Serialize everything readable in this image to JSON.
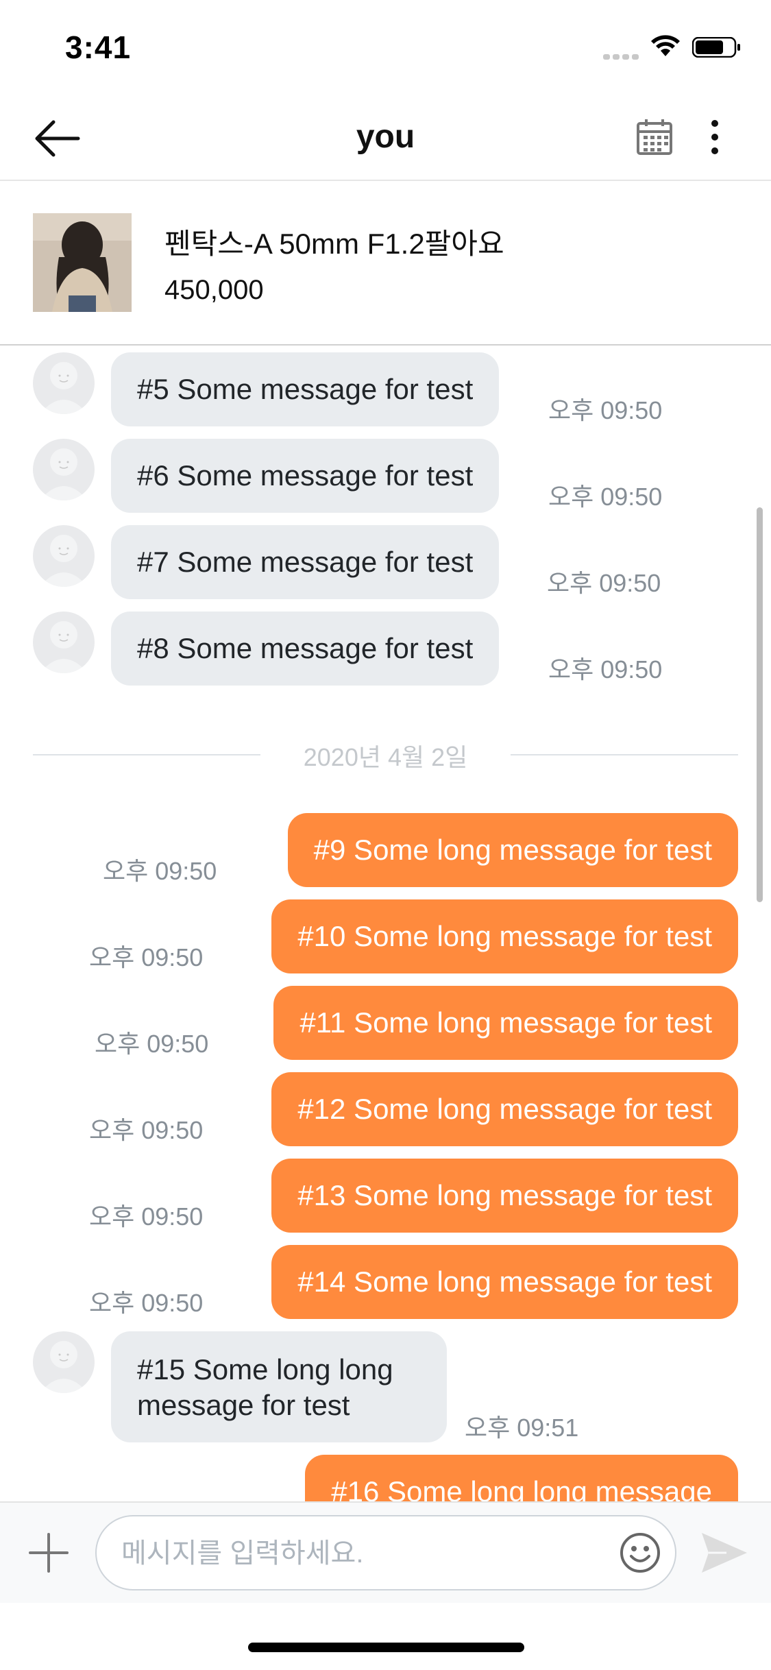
{
  "status_bar": {
    "time": "3:41"
  },
  "header": {
    "title": "you"
  },
  "product": {
    "title": "펜탁스-A 50mm F1.2팔아요",
    "price": "450,000"
  },
  "date_separator": "2020년 4월 2일",
  "messages": [
    {
      "id": 5,
      "side": "in",
      "text": "#5 Some message for test",
      "time": "오후 09:50"
    },
    {
      "id": 6,
      "side": "in",
      "text": "#6 Some message for test",
      "time": "오후 09:50"
    },
    {
      "id": 7,
      "side": "in",
      "text": "#7 Some message for test",
      "time": "오후 09:50"
    },
    {
      "id": 8,
      "side": "in",
      "text": "#8 Some message for test",
      "time": "오후 09:50"
    },
    {
      "id": 9,
      "side": "out",
      "text": "#9 Some long message for test",
      "time": "오후 09:50"
    },
    {
      "id": 10,
      "side": "out",
      "text": "#10 Some long message for test",
      "time": "오후 09:50"
    },
    {
      "id": 11,
      "side": "out",
      "text": "#11 Some long message for test",
      "time": "오후 09:50"
    },
    {
      "id": 12,
      "side": "out",
      "text": "#12 Some long message for test",
      "time": "오후 09:50"
    },
    {
      "id": 13,
      "side": "out",
      "text": "#13 Some long message for test",
      "time": "오후 09:50"
    },
    {
      "id": 14,
      "side": "out",
      "text": "#14 Some long message for test",
      "time": "오후 09:50"
    },
    {
      "id": 15,
      "side": "in",
      "text": "#15 Some long long message for test",
      "time": "오후 09:51"
    },
    {
      "id": 16,
      "side": "out",
      "text": "#16 Some long long message",
      "time": ""
    }
  ],
  "input": {
    "placeholder": "메시지를 입력하세요.",
    "value": ""
  },
  "icons": {
    "back": "arrow-left-icon",
    "calendar": "calendar-icon",
    "more": "more-vertical-icon",
    "plus": "plus-icon",
    "emoji": "smile-icon",
    "send": "send-icon",
    "wifi": "wifi-icon",
    "battery": "battery-icon"
  },
  "colors": {
    "accent": "#ff8a3d",
    "incoming_bubble": "#e9ecef",
    "time_text": "#868e96"
  }
}
